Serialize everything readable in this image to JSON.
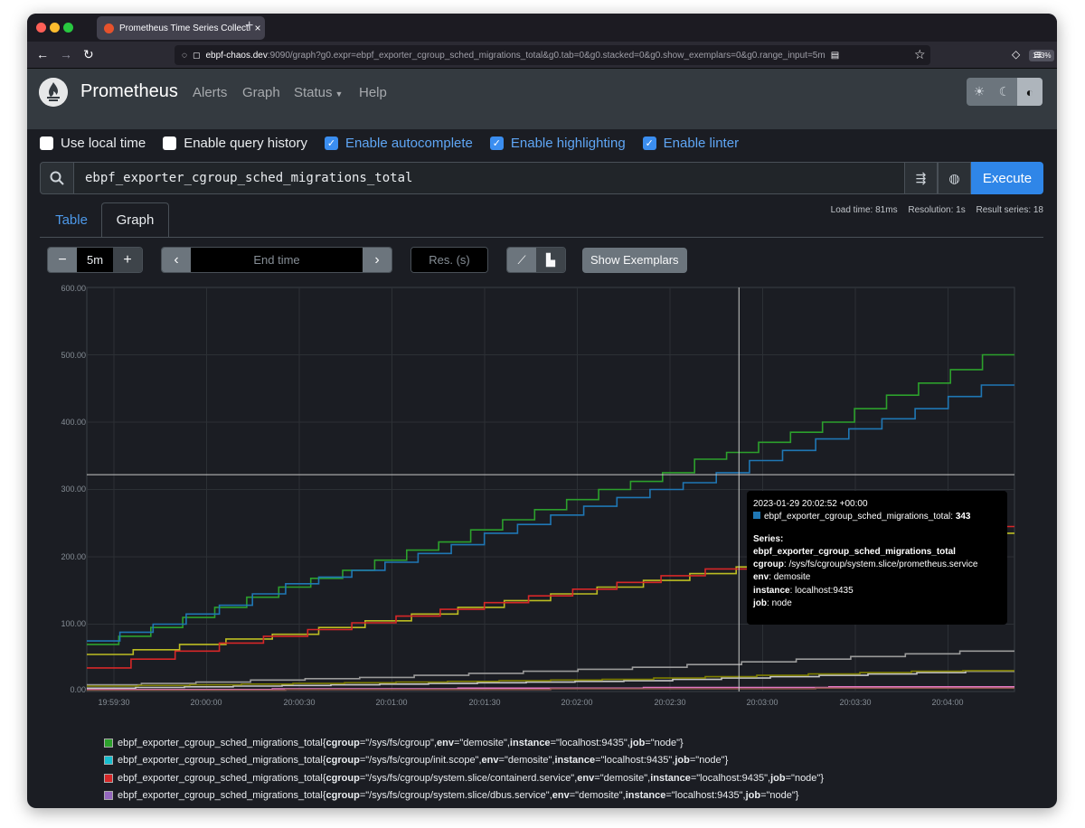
{
  "browser": {
    "tab_title": "Prometheus Time Series Collecti",
    "url_host": "ebpf-chaos.dev",
    "url_rest": ":9090/graph?g0.expr=ebpf_exporter_cgroup_sched_migrations_total&g0.tab=0&g0.stacked=0&g0.show_exemplars=0&g0.range_input=5m",
    "zoom": "133%",
    "new_tab_label": "+",
    "close_tab": "×"
  },
  "nav": {
    "brand": "Prometheus",
    "links": [
      "Alerts",
      "Graph",
      "Status",
      "Help"
    ]
  },
  "options": [
    {
      "label": "Use local time",
      "checked": false
    },
    {
      "label": "Enable query history",
      "checked": false
    },
    {
      "label": "Enable autocomplete",
      "checked": true
    },
    {
      "label": "Enable highlighting",
      "checked": true
    },
    {
      "label": "Enable linter",
      "checked": true
    }
  ],
  "query": {
    "expression": "ebpf_exporter_cgroup_sched_migrations_total",
    "execute_label": "Execute"
  },
  "tabs": {
    "table": "Table",
    "graph": "Graph"
  },
  "stats": {
    "load_time": "Load time: 81ms",
    "resolution": "Resolution: 1s",
    "result_series": "Result series: 18"
  },
  "controls": {
    "range": "5m",
    "minus": "−",
    "plus": "+",
    "end_time_placeholder": "End time",
    "res_placeholder": "Res. (s)",
    "show_exemplars": "Show Exemplars",
    "prev": "‹",
    "next": "›"
  },
  "chart_data": {
    "type": "line",
    "y_ticks": [
      "0.00",
      "100.00",
      "200.00",
      "300.00",
      "400.00",
      "500.00",
      "600.00"
    ],
    "x_ticks": [
      "19:59:30",
      "20:00:00",
      "20:00:30",
      "20:01:00",
      "20:01:30",
      "20:02:00",
      "20:02:30",
      "20:03:00",
      "20:03:30",
      "20:04:00"
    ],
    "ylim": [
      0,
      600
    ],
    "grid": true,
    "series": [
      {
        "color": "#2ca02c",
        "values": [
          70,
          82,
          95,
          110,
          125,
          140,
          155,
          168,
          180,
          195,
          210,
          222,
          240,
          255,
          270,
          285,
          300,
          312,
          325,
          345,
          355,
          370,
          385,
          400,
          420,
          440,
          458,
          478,
          500
        ]
      },
      {
        "color": "#1f77b4",
        "values": [
          75,
          88,
          100,
          115,
          128,
          145,
          160,
          170,
          180,
          192,
          205,
          218,
          235,
          248,
          262,
          275,
          288,
          300,
          310,
          325,
          343,
          358,
          375,
          390,
          405,
          420,
          438,
          455
        ]
      },
      {
        "color": "#bcbd22",
        "values": [
          55,
          62,
          70,
          78,
          85,
          95,
          105,
          115,
          125,
          135,
          145,
          155,
          165,
          175,
          185,
          195,
          205,
          215,
          225,
          235
        ]
      },
      {
        "color": "#d62728",
        "values": [
          35,
          48,
          60,
          72,
          82,
          92,
          102,
          112,
          122,
          132,
          142,
          152,
          162,
          172,
          182,
          192,
          202,
          212,
          222,
          232,
          245
        ]
      },
      {
        "color": "#9a9a9a",
        "values": [
          10,
          12,
          14,
          17,
          19,
          21,
          24,
          27,
          30,
          33,
          36,
          40,
          44,
          48,
          52,
          56,
          60
        ]
      },
      {
        "color": "#c7c7c7",
        "values": [
          5,
          6,
          7,
          8,
          9,
          10,
          11,
          12,
          13,
          14,
          15,
          16,
          18,
          20,
          22,
          24,
          26,
          28,
          30
        ]
      },
      {
        "color": "#7f7f00",
        "values": [
          8,
          9,
          10,
          11,
          12,
          13,
          14,
          15,
          16,
          17,
          18,
          20,
          22,
          24,
          26,
          28,
          30,
          31
        ]
      },
      {
        "color": "#e377c2",
        "values": [
          3,
          3,
          3,
          4,
          4,
          4,
          5,
          5,
          5,
          6,
          6,
          6,
          7,
          7,
          7
        ]
      },
      {
        "color": "#8c564b",
        "values": [
          2,
          2,
          2,
          3,
          3,
          3,
          3,
          4,
          4,
          4,
          4,
          5,
          5,
          5
        ]
      }
    ],
    "crosshair": {
      "x_fraction": 0.703,
      "y": 322
    }
  },
  "tooltip": {
    "time": "2023-01-29 20:02:52 +00:00",
    "metric": "ebpf_exporter_cgroup_sched_migrations_total:",
    "value": "343",
    "series_label": "Series:",
    "series_name": "ebpf_exporter_cgroup_sched_migrations_total",
    "labels": [
      {
        "k": "cgroup",
        "v": "/sys/fs/cgroup/system.slice/prometheus.service"
      },
      {
        "k": "env",
        "v": "demosite"
      },
      {
        "k": "instance",
        "v": "localhost:9435"
      },
      {
        "k": "job",
        "v": "node"
      }
    ]
  },
  "legend": [
    {
      "color": "#2ca02c",
      "metric": "ebpf_exporter_cgroup_sched_migrations_total{",
      "cgroup": "\"/sys/fs/cgroup\"",
      "env": "\"demosite\"",
      "instance": "\"localhost:9435\"",
      "job": "\"node\"}"
    },
    {
      "color": "#17becf",
      "metric": "ebpf_exporter_cgroup_sched_migrations_total{",
      "cgroup": "\"/sys/fs/cgroup/init.scope\"",
      "env": "\"demosite\"",
      "instance": "\"localhost:9435\"",
      "job": "\"node\"}"
    },
    {
      "color": "#d62728",
      "metric": "ebpf_exporter_cgroup_sched_migrations_total{",
      "cgroup": "\"/sys/fs/cgroup/system.slice/containerd.service\"",
      "env": "\"demosite\"",
      "instance": "\"localhost:9435\"",
      "job": "\"node\"}"
    },
    {
      "color": "#9467bd",
      "metric": "ebpf_exporter_cgroup_sched_migrations_total{",
      "cgroup": "\"/sys/fs/cgroup/system.slice/dbus.service\"",
      "env": "\"demosite\"",
      "instance": "\"localhost:9435\"",
      "job": "\"node\"}"
    }
  ]
}
